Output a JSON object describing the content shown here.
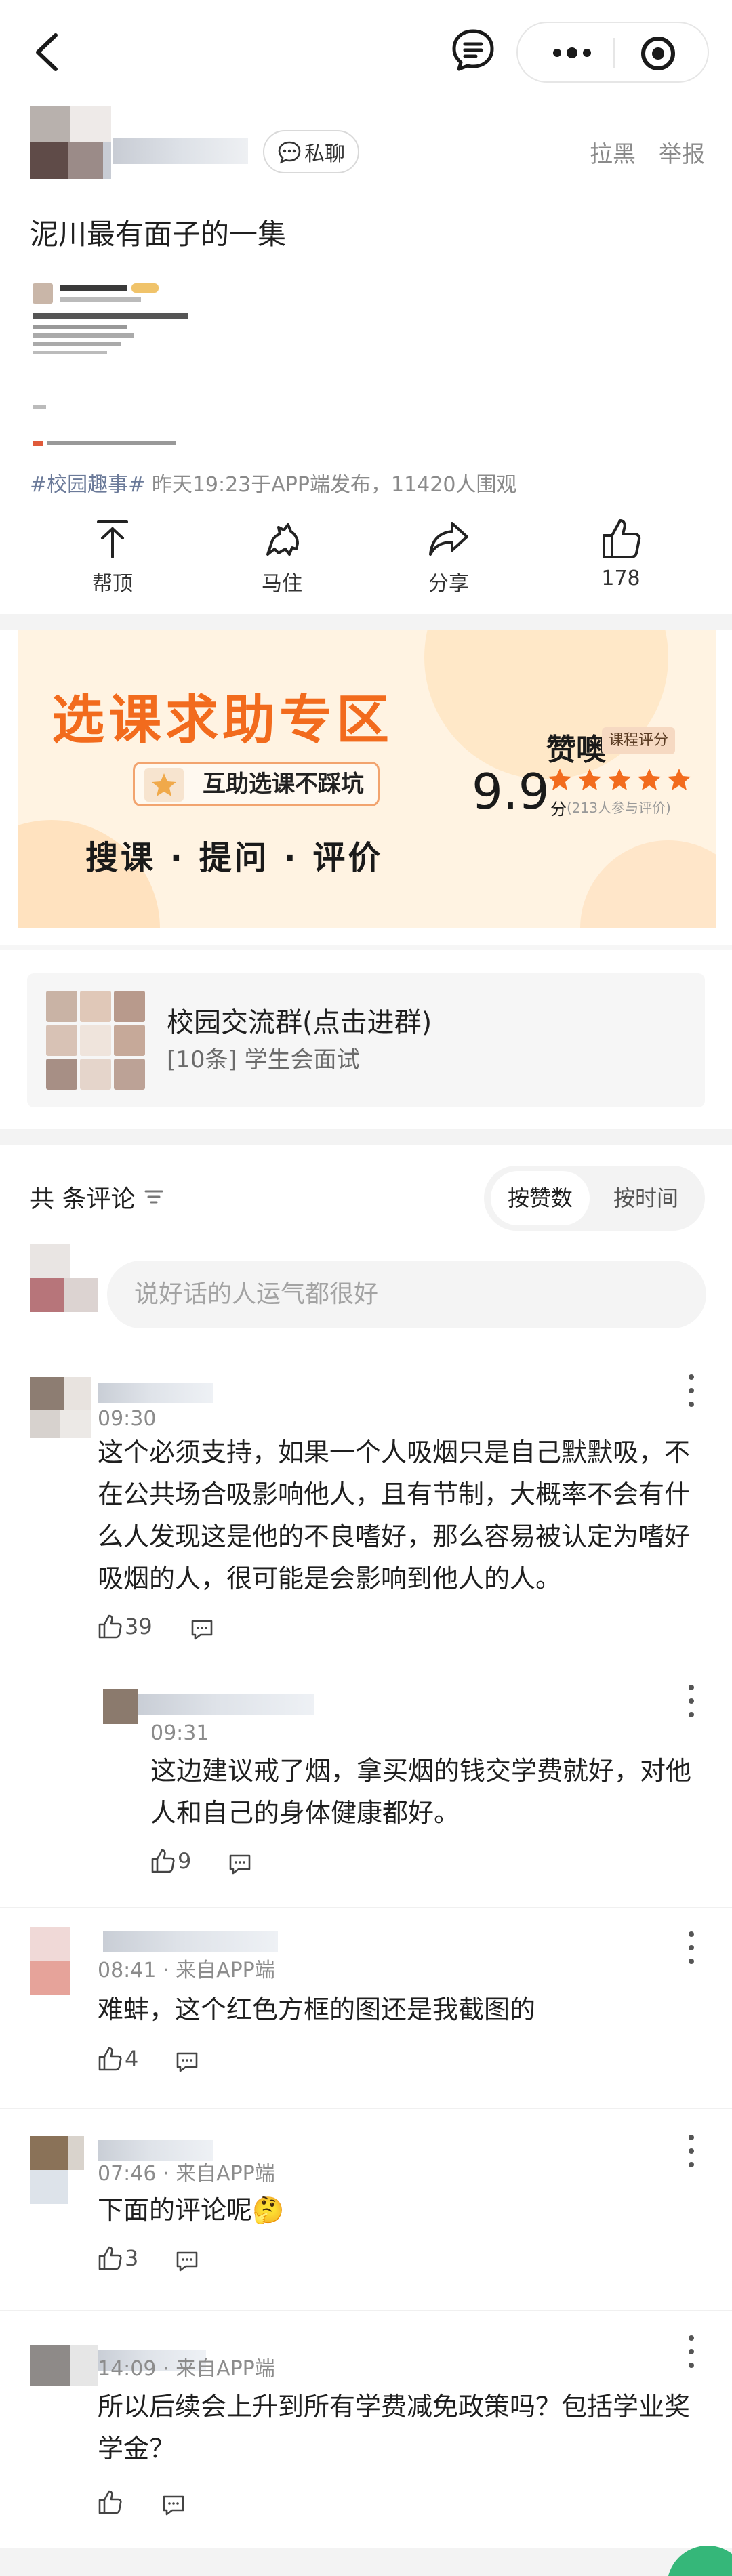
{
  "header": {
    "back_icon": "chevron-left-icon",
    "message_icon": "message-list-icon",
    "more_icon": "ellipsis-icon",
    "close_icon": "target-icon"
  },
  "author": {
    "dm_label": "私聊",
    "block_label": "拉黑",
    "report_label": "举报"
  },
  "post": {
    "title": "泥川最有面子的一集",
    "tag": "#校园趣事#",
    "meta": " 昨天19:23于APP端发布，11420人围观"
  },
  "actions": {
    "top": "帮顶",
    "horse": "马住",
    "share": "分享",
    "like_count": "178"
  },
  "banner": {
    "title": "选课求助专区",
    "subtitle": "互助选课不踩坑",
    "slogan": "搜课 · 提问 · 评价",
    "brand": "赞噢",
    "badge": "课程评分",
    "score": "9.9",
    "score_unit": "分",
    "people": "(213人参与评价)"
  },
  "group": {
    "name": "校园交流群(点击进群)",
    "latest": "[10条] 学生会面试"
  },
  "comments_header": {
    "title": "共 条评论",
    "sort_hot": "按赞数",
    "sort_time": "按时间",
    "input_placeholder": "说好话的人运气都很好"
  },
  "comments": [
    {
      "time": "09:30",
      "text": "这个必须支持，如果一个人吸烟只是自己默默吸，不在公共场合吸影响他人，且有节制，大概率不会有什么人发现这是他的不良嗜好，那么容易被认定为嗜好吸烟的人，很可能是会影响到他人的人。",
      "likes": "39"
    },
    {
      "time": "09:31",
      "text": "这边建议戒了烟，拿买烟的钱交学费就好，对他人和自己的身体健康都好。",
      "likes": "9"
    },
    {
      "time": "08:41 · 来自APP端",
      "text": "难蚌，这个红色方框的图还是我截图的",
      "likes": "4"
    },
    {
      "time": "07:46 · 来自APP端",
      "text": "下面的评论呢🤔",
      "likes": "3"
    },
    {
      "time": "14:09 · 来自APP端",
      "text": "所以后续会上升到所有学费减免政策吗？包括学业奖学金？",
      "likes": ""
    }
  ]
}
